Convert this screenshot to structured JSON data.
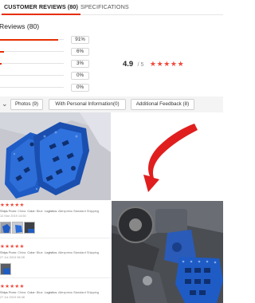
{
  "tabs": [
    {
      "label": "CUSTOMER REVIEWS (80)"
    },
    {
      "label": "SPECIFICATIONS"
    }
  ],
  "reviews_title": "Reviews (80)",
  "breakdown": [
    {
      "pct_text": "91%",
      "fill": 0.91
    },
    {
      "pct_text": "6%",
      "fill": 0.06
    },
    {
      "pct_text": "3%",
      "fill": 0.03
    },
    {
      "pct_text": "0%",
      "fill": 0
    },
    {
      "pct_text": "0%",
      "fill": 0
    }
  ],
  "rating": {
    "score": "4.9",
    "out_of": "/ 5",
    "stars": "★★★★★"
  },
  "filters": {
    "photos": "Photos (9)",
    "personal": "With Personal Information(0)",
    "additional": "Additional Feedback (8)"
  },
  "colors": {
    "accent": "#e62e04",
    "star": "#f0483a",
    "part_blue": "#1f5bc4"
  },
  "reviews": [
    {
      "stars": "★★★★★",
      "ships_label": "Ships From:",
      "ships": "China",
      "color_label": "Color:",
      "color": "Blue",
      "logistics_label": "Logistics:",
      "logistics": "Aliexpress Standard Shipping",
      "date": "12 Mar 2019 14:50"
    },
    {
      "stars": "★★★★★",
      "ships_label": "Ships From:",
      "ships": "China",
      "color_label": "Color:",
      "color": "Blue",
      "logistics_label": "Logistics:",
      "logistics": "Aliexpress Standard Shipping",
      "date": "27 Jul 2019 08:28"
    },
    {
      "stars": "★★★★★",
      "ships_label": "Ships From:",
      "ships": "China",
      "color_label": "Color:",
      "color": "Blue",
      "logistics_label": "Logistics:",
      "logistics": "Aliexpress Standard Shipping",
      "date": "27 Jul 2019 08:48"
    }
  ]
}
